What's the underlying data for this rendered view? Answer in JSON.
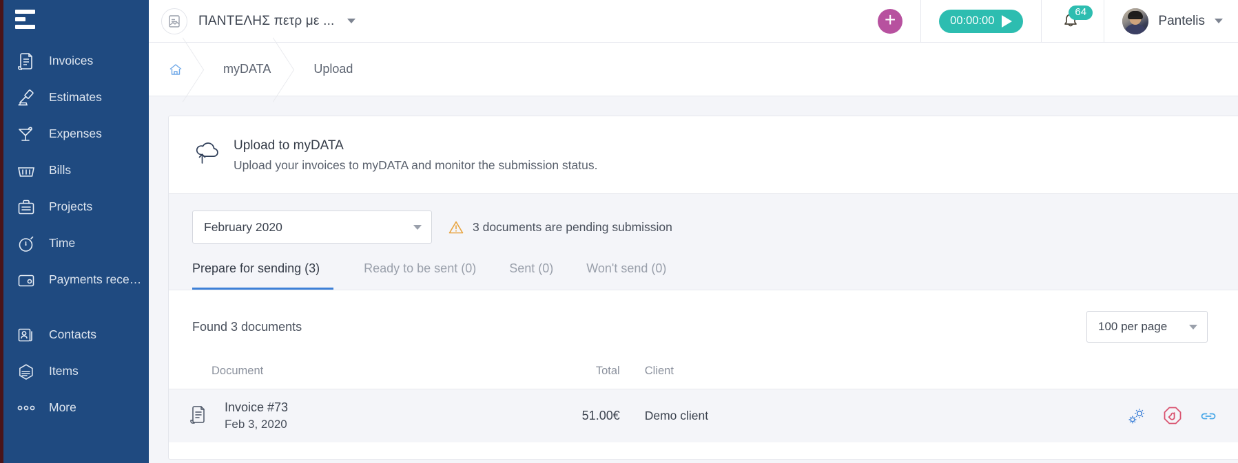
{
  "sidebar": {
    "menu_icon": "hamburger-icon",
    "items": [
      {
        "label": "Invoices",
        "icon": "invoice-icon"
      },
      {
        "label": "Estimates",
        "icon": "gavel-icon"
      },
      {
        "label": "Expenses",
        "icon": "cocktail-icon"
      },
      {
        "label": "Bills",
        "icon": "basket-icon"
      },
      {
        "label": "Projects",
        "icon": "briefcase-icon"
      },
      {
        "label": "Time",
        "icon": "stopwatch-icon"
      },
      {
        "label": "Payments rece…",
        "icon": "wallet-icon"
      }
    ],
    "items2": [
      {
        "label": "Contacts",
        "icon": "contacts-icon"
      },
      {
        "label": "Items",
        "icon": "items-icon"
      },
      {
        "label": "More",
        "icon": "ellipsis-icon"
      }
    ]
  },
  "topbar": {
    "company_name": "ΠΑΝΤΕΛΗΣ πετρ με ...",
    "company_icon": "document-avatar-icon",
    "company_caret": "chevron-down-icon",
    "add_button": "+",
    "timer_value": "00:00:00",
    "timer_play": "play-icon",
    "notifications_count": "64",
    "bell_icon": "bell-icon",
    "user_name": "Pantelis",
    "user_caret": "chevron-down-icon"
  },
  "breadcrumb": {
    "home_icon": "home-icon",
    "items": [
      {
        "label": "myDATA"
      },
      {
        "label": "Upload"
      }
    ]
  },
  "card": {
    "icon": "cloud-upload-icon",
    "title": "Upload to myDATA",
    "subtitle": "Upload your invoices to myDATA and monitor the submission status."
  },
  "toolbar": {
    "period_value": "February 2020",
    "period_caret": "chevron-down-icon",
    "warning_icon": "warning-triangle-icon",
    "warning_text": "3 documents are pending submission",
    "tabs": [
      {
        "label": "Prepare for sending (3)",
        "active": true
      },
      {
        "label": "Ready to be sent (0)",
        "active": false
      },
      {
        "label": "Sent (0)",
        "active": false
      },
      {
        "label": "Won't send (0)",
        "active": false
      }
    ]
  },
  "list": {
    "found_text": "Found 3 documents",
    "per_page_value": "100 per page",
    "per_page_caret": "chevron-down-icon",
    "columns": {
      "document": "Document",
      "total": "Total",
      "client": "Client"
    },
    "rows": [
      {
        "icon": "invoice-document-icon",
        "name": "Invoice #73",
        "date": "Feb 3, 2020",
        "total": "51.00€",
        "client": "Demo client",
        "actions": [
          "gears-icon",
          "stop-hand-icon",
          "link-icon"
        ]
      }
    ]
  },
  "colors": {
    "sidebar_bg": "#1f4a80",
    "sidebar_edge": "#4a1418",
    "accent_blue": "#3d80d7",
    "teal": "#2dbdb0",
    "magenta": "#b7519f",
    "warning_amber": "#e8a33d",
    "danger_pink": "#d9526f",
    "page_bg": "#f4f5f9"
  }
}
